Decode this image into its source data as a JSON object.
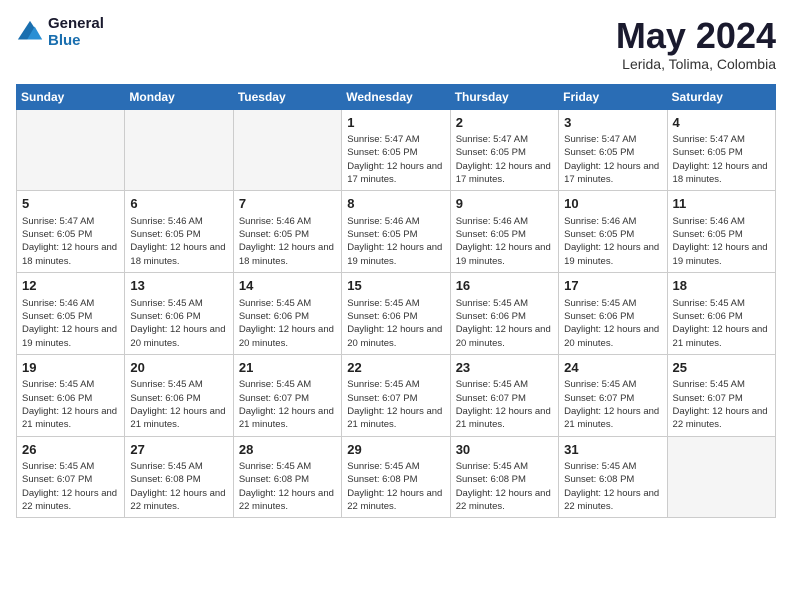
{
  "header": {
    "logo_general": "General",
    "logo_blue": "Blue",
    "month": "May 2024",
    "location": "Lerida, Tolima, Colombia"
  },
  "days_of_week": [
    "Sunday",
    "Monday",
    "Tuesday",
    "Wednesday",
    "Thursday",
    "Friday",
    "Saturday"
  ],
  "weeks": [
    [
      {
        "day": "",
        "info": ""
      },
      {
        "day": "",
        "info": ""
      },
      {
        "day": "",
        "info": ""
      },
      {
        "day": "1",
        "info": "Sunrise: 5:47 AM\nSunset: 6:05 PM\nDaylight: 12 hours\nand 17 minutes."
      },
      {
        "day": "2",
        "info": "Sunrise: 5:47 AM\nSunset: 6:05 PM\nDaylight: 12 hours\nand 17 minutes."
      },
      {
        "day": "3",
        "info": "Sunrise: 5:47 AM\nSunset: 6:05 PM\nDaylight: 12 hours\nand 17 minutes."
      },
      {
        "day": "4",
        "info": "Sunrise: 5:47 AM\nSunset: 6:05 PM\nDaylight: 12 hours\nand 18 minutes."
      }
    ],
    [
      {
        "day": "5",
        "info": "Sunrise: 5:47 AM\nSunset: 6:05 PM\nDaylight: 12 hours\nand 18 minutes."
      },
      {
        "day": "6",
        "info": "Sunrise: 5:46 AM\nSunset: 6:05 PM\nDaylight: 12 hours\nand 18 minutes."
      },
      {
        "day": "7",
        "info": "Sunrise: 5:46 AM\nSunset: 6:05 PM\nDaylight: 12 hours\nand 18 minutes."
      },
      {
        "day": "8",
        "info": "Sunrise: 5:46 AM\nSunset: 6:05 PM\nDaylight: 12 hours\nand 19 minutes."
      },
      {
        "day": "9",
        "info": "Sunrise: 5:46 AM\nSunset: 6:05 PM\nDaylight: 12 hours\nand 19 minutes."
      },
      {
        "day": "10",
        "info": "Sunrise: 5:46 AM\nSunset: 6:05 PM\nDaylight: 12 hours\nand 19 minutes."
      },
      {
        "day": "11",
        "info": "Sunrise: 5:46 AM\nSunset: 6:05 PM\nDaylight: 12 hours\nand 19 minutes."
      }
    ],
    [
      {
        "day": "12",
        "info": "Sunrise: 5:46 AM\nSunset: 6:05 PM\nDaylight: 12 hours\nand 19 minutes."
      },
      {
        "day": "13",
        "info": "Sunrise: 5:45 AM\nSunset: 6:06 PM\nDaylight: 12 hours\nand 20 minutes."
      },
      {
        "day": "14",
        "info": "Sunrise: 5:45 AM\nSunset: 6:06 PM\nDaylight: 12 hours\nand 20 minutes."
      },
      {
        "day": "15",
        "info": "Sunrise: 5:45 AM\nSunset: 6:06 PM\nDaylight: 12 hours\nand 20 minutes."
      },
      {
        "day": "16",
        "info": "Sunrise: 5:45 AM\nSunset: 6:06 PM\nDaylight: 12 hours\nand 20 minutes."
      },
      {
        "day": "17",
        "info": "Sunrise: 5:45 AM\nSunset: 6:06 PM\nDaylight: 12 hours\nand 20 minutes."
      },
      {
        "day": "18",
        "info": "Sunrise: 5:45 AM\nSunset: 6:06 PM\nDaylight: 12 hours\nand 21 minutes."
      }
    ],
    [
      {
        "day": "19",
        "info": "Sunrise: 5:45 AM\nSunset: 6:06 PM\nDaylight: 12 hours\nand 21 minutes."
      },
      {
        "day": "20",
        "info": "Sunrise: 5:45 AM\nSunset: 6:06 PM\nDaylight: 12 hours\nand 21 minutes."
      },
      {
        "day": "21",
        "info": "Sunrise: 5:45 AM\nSunset: 6:07 PM\nDaylight: 12 hours\nand 21 minutes."
      },
      {
        "day": "22",
        "info": "Sunrise: 5:45 AM\nSunset: 6:07 PM\nDaylight: 12 hours\nand 21 minutes."
      },
      {
        "day": "23",
        "info": "Sunrise: 5:45 AM\nSunset: 6:07 PM\nDaylight: 12 hours\nand 21 minutes."
      },
      {
        "day": "24",
        "info": "Sunrise: 5:45 AM\nSunset: 6:07 PM\nDaylight: 12 hours\nand 21 minutes."
      },
      {
        "day": "25",
        "info": "Sunrise: 5:45 AM\nSunset: 6:07 PM\nDaylight: 12 hours\nand 22 minutes."
      }
    ],
    [
      {
        "day": "26",
        "info": "Sunrise: 5:45 AM\nSunset: 6:07 PM\nDaylight: 12 hours\nand 22 minutes."
      },
      {
        "day": "27",
        "info": "Sunrise: 5:45 AM\nSunset: 6:08 PM\nDaylight: 12 hours\nand 22 minutes."
      },
      {
        "day": "28",
        "info": "Sunrise: 5:45 AM\nSunset: 6:08 PM\nDaylight: 12 hours\nand 22 minutes."
      },
      {
        "day": "29",
        "info": "Sunrise: 5:45 AM\nSunset: 6:08 PM\nDaylight: 12 hours\nand 22 minutes."
      },
      {
        "day": "30",
        "info": "Sunrise: 5:45 AM\nSunset: 6:08 PM\nDaylight: 12 hours\nand 22 minutes."
      },
      {
        "day": "31",
        "info": "Sunrise: 5:45 AM\nSunset: 6:08 PM\nDaylight: 12 hours\nand 22 minutes."
      },
      {
        "day": "",
        "info": ""
      }
    ]
  ]
}
